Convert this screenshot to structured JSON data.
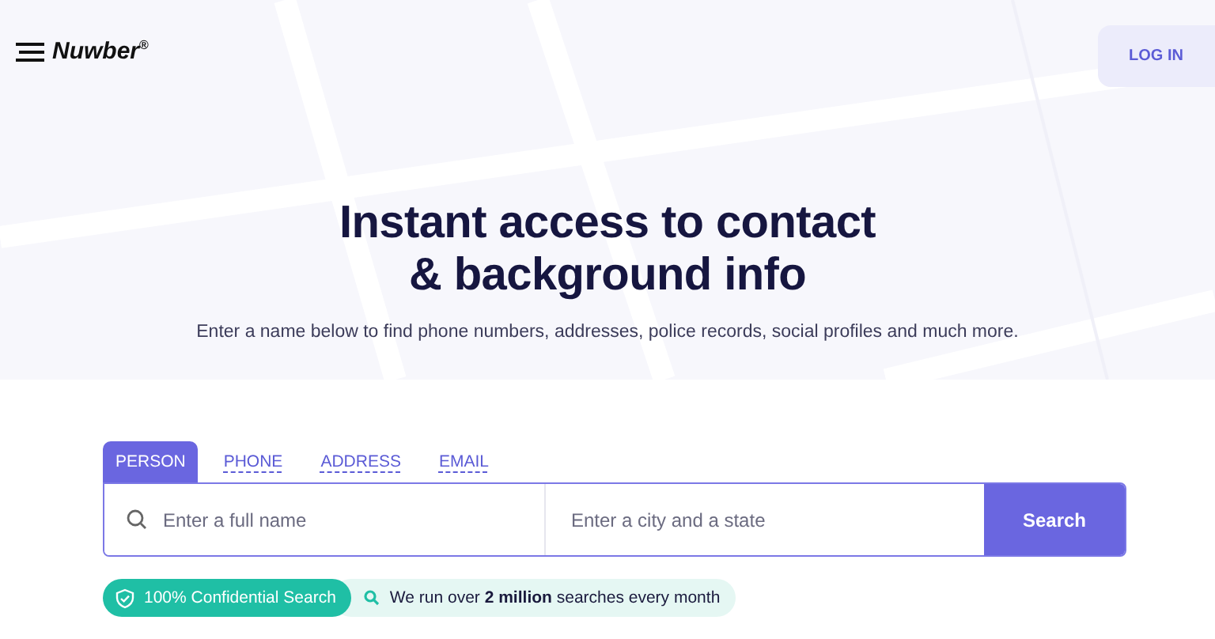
{
  "header": {
    "logo": "Nuwber$^{®}$",
    "login": "LOG IN"
  },
  "hero": {
    "title_lines": [
      "Instant access to contact",
      "& background info"
    ],
    "subtitle": "Enter a name below to find phone numbers, addresses, police records, social profiles and much more."
  },
  "search": {
    "tabs": [
      {
        "label": "PERSON",
        "selected": true
      },
      {
        "label": "PHONE",
        "selected": false
      },
      {
        "label": "ADDRESS",
        "selected": false
      },
      {
        "label": "EMAIL",
        "selected": false
      }
    ],
    "name_field": {
      "placeholder": "Enter a full name"
    },
    "location_field": {
      "placeholder": "Enter a city and a state"
    },
    "button": "Search"
  },
  "badges": [
    {
      "kind": "shield",
      "text": "100% Confidential Search"
    },
    {
      "kind": "search",
      "text": "We run over **2 million** searches every month"
    }
  ]
}
